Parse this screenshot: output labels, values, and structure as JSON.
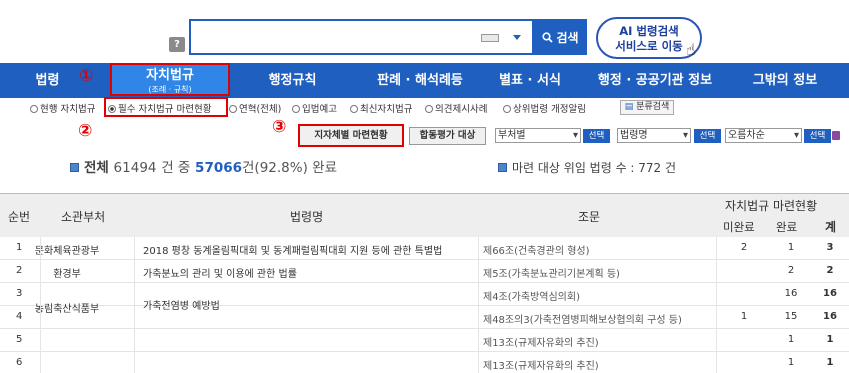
{
  "search": {
    "help_label": "?",
    "button_label": "검색",
    "ai_line1": "AI 법령검색",
    "ai_line2": "서비스로 이동"
  },
  "nav": {
    "items": [
      "법령",
      "자치법규",
      "행정규칙",
      "판례 · 해석례등",
      "별표 · 서식",
      "행정 · 공공기관 정보",
      "그밖의 정보"
    ],
    "active_sub": "(조례 · 규칙)"
  },
  "annotations": [
    "①",
    "②",
    "③"
  ],
  "options": {
    "items": [
      "현행 자치법규",
      "필수 자치법규 마련현황",
      "연혁(전체)",
      "입법예고",
      "최신자치법규",
      "의견제시사례",
      "상위법령 개정알림"
    ],
    "selected": "필수 자치법규 마련현황",
    "category_search": "분류검색"
  },
  "filters": {
    "status_button": "지자체별 마련현황",
    "joint_button": "합동평가 대상",
    "selects": [
      "부처별",
      "법령명",
      "오름차순"
    ],
    "select_button": "선택"
  },
  "summary": {
    "prefix": "전체",
    "total": "61494",
    "mid": "건 중",
    "done": "57066",
    "pct": "건(92.8%) 완료",
    "right": "마련 대상 위임 법령 수 : 772 건"
  },
  "table": {
    "headers": {
      "seq": "순번",
      "dept": "소관부처",
      "law": "법령명",
      "article": "조문",
      "group": "자치법규 마련현황",
      "undone": "미완료",
      "done": "완료",
      "total": "계"
    },
    "rows": [
      {
        "seq": "1",
        "dept": "문화체육관광부",
        "law": "2018 평창 동계올림픽대회 및 동계패럴림픽대회 지원 등에 관한 특별법",
        "article": "제66조(건축경관의 형성)",
        "undone": "2",
        "done": "1",
        "total": "3"
      },
      {
        "seq": "2",
        "dept": "환경부",
        "law": "가축분뇨의 관리 및 이용에 관한 법률",
        "article": "제5조(가축분뇨관리기본계획 등)",
        "undone": "",
        "done": "2",
        "total": "2"
      },
      {
        "seq": "3",
        "dept": "",
        "law": "",
        "article": "제4조(가축방역심의회)",
        "undone": "",
        "done": "16",
        "total": "16"
      },
      {
        "seq": "4",
        "dept": "",
        "law": "",
        "article": "제48조의3(가축전염병피해보상협의회 구성 등)",
        "undone": "1",
        "done": "15",
        "total": "16"
      },
      {
        "seq": "5",
        "dept": "",
        "law": "",
        "article": "제13조(규제자유화의 추진)",
        "undone": "",
        "done": "1",
        "total": "1"
      },
      {
        "seq": "6",
        "dept": "",
        "law": "",
        "article": "제13조(규제자유화의 추진)",
        "undone": "",
        "done": "1",
        "total": "1"
      }
    ],
    "merged": {
      "dept_34": "농림축산식품부",
      "law_34": "가축전염병 예방법"
    }
  }
}
